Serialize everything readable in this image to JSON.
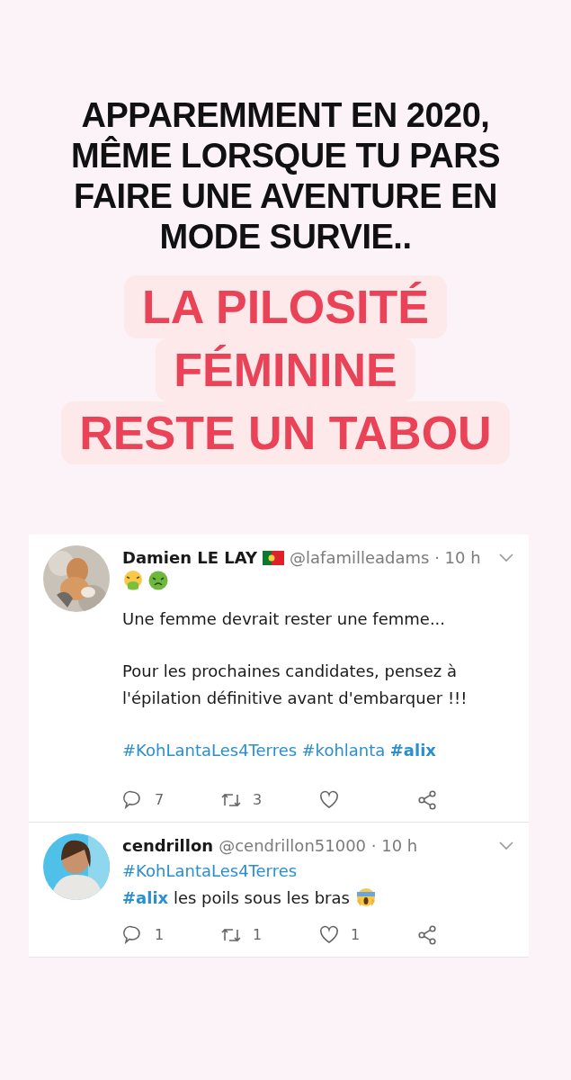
{
  "headline": [
    "APPAREMMENT EN 2020,",
    "MÊME LORSQUE TU PARS",
    "FAIRE UNE AVENTURE EN",
    "MODE SURVIE.."
  ],
  "highlight": [
    "LA PILOSITÉ",
    "FÉMININE",
    "RESTE UN TABOU"
  ],
  "tweets": [
    {
      "name": "Damien LE LAY",
      "flag": true,
      "handle": "@lafamilleadams · 10 h",
      "blocks": [
        {
          "kind": "emoji",
          "icons": [
            {
              "kind": "vomit"
            },
            {
              "kind": "sick"
            }
          ]
        },
        {
          "kind": "text",
          "segments": [
            {
              "kind": "plain",
              "text": "Une femme devrait rester une femme..."
            }
          ]
        },
        {
          "kind": "text",
          "segments": [
            {
              "kind": "plain",
              "text": "Pour les prochaines candidates, pensez à l'épilation définitive avant d'embarquer !!!"
            }
          ]
        },
        {
          "kind": "text",
          "segments": [
            {
              "kind": "hashtag",
              "text": "#KohLantaLes4Terres",
              "bold": false
            },
            {
              "kind": "hashtag",
              "text": "#kohlanta",
              "bold": false
            },
            {
              "kind": "hashtag",
              "text": "#alix",
              "bold": true
            }
          ]
        }
      ],
      "replies": "7",
      "retweets": "3"
    },
    {
      "name": "cendrillon",
      "flag": false,
      "handle": "@cendrillon51000 · 10 h",
      "blocks": [
        {
          "kind": "tight",
          "segments": [
            {
              "kind": "hashtag",
              "text": "#KohLantaLes4Terres",
              "bold": false
            }
          ]
        },
        {
          "kind": "tight",
          "segments": [
            {
              "kind": "hashtag",
              "text": "#alix",
              "bold": true
            },
            {
              "kind": "plain",
              "text": " les poils sous les bras "
            },
            {
              "kind": "scream"
            }
          ]
        }
      ],
      "replies": "1",
      "retweets": "1",
      "likes": "1"
    }
  ]
}
